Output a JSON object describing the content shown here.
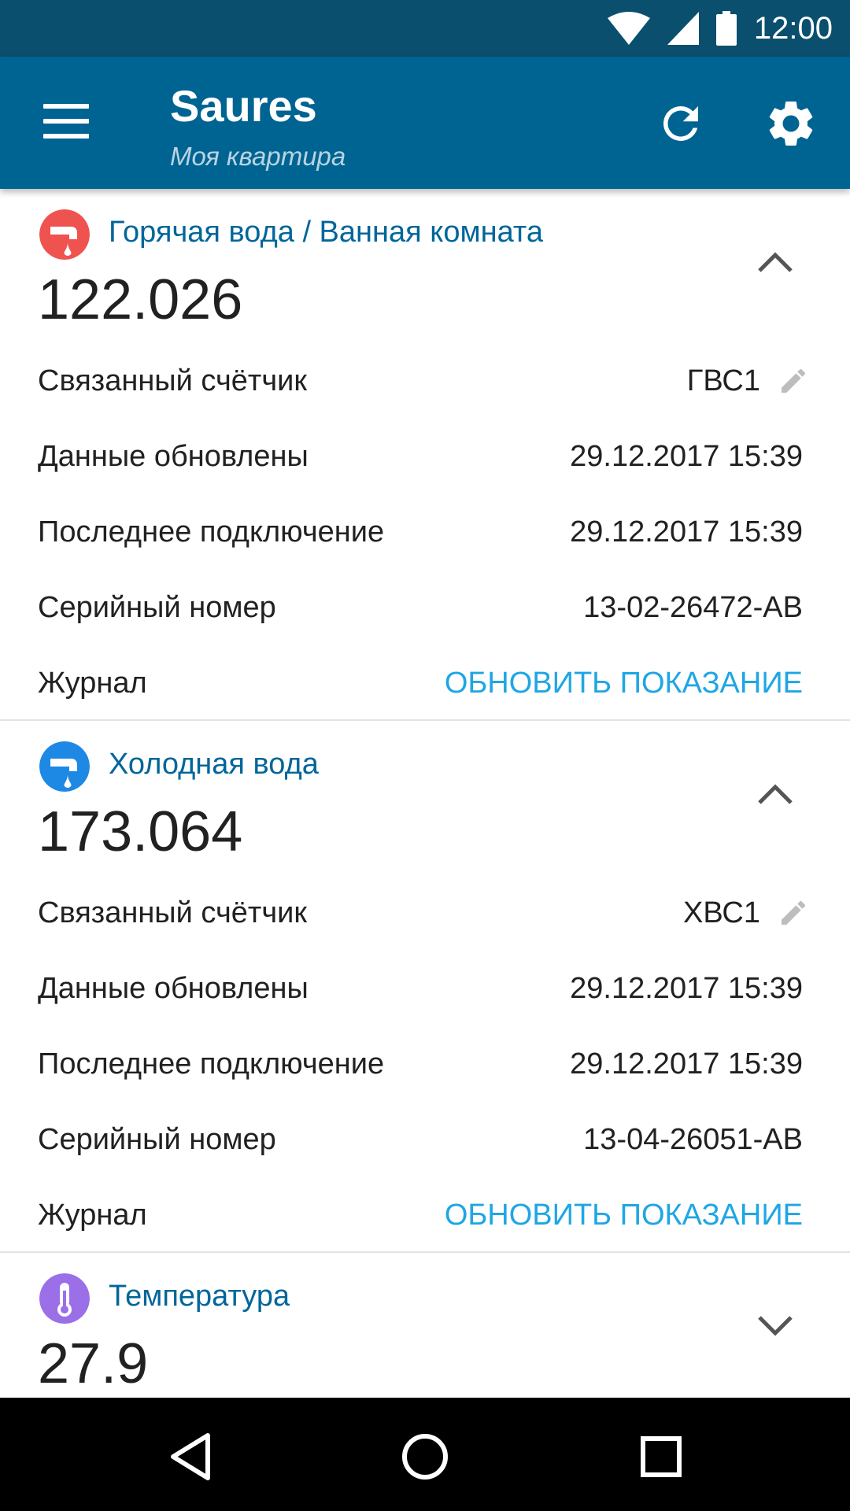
{
  "status_bar": {
    "time": "12:00",
    "icons": [
      "wifi-icon",
      "signal-icon",
      "battery-icon"
    ]
  },
  "app_bar": {
    "title": "Saures",
    "subtitle": "Моя квартира",
    "icons": [
      "menu-icon",
      "refresh-icon",
      "settings-icon"
    ]
  },
  "colors": {
    "accent": "#006493",
    "status": "#0b4f6e",
    "title_text": "#00669a",
    "link": "#1fa6e3",
    "hot": "#ef5350",
    "cold": "#1e88e5",
    "temp": "#9b6fe8"
  },
  "cards": [
    {
      "icon": "hot-water-icon",
      "title": "Горячая вода / Ванная комната",
      "value": "122.026",
      "expanded": true,
      "rows": {
        "linked_label": "Связанный счётчик",
        "linked_value": "ГВС1",
        "updated_label": "Данные обновлены",
        "updated_value": "29.12.2017 15:39",
        "connection_label": "Последнее подключение",
        "connection_value": "29.12.2017 15:39",
        "serial_label": "Серийный номер",
        "serial_value": "13-02-26472-AB",
        "journal_label": "Журнал",
        "update_action": "ОБНОВИТЬ ПОКАЗАНИЕ"
      }
    },
    {
      "icon": "cold-water-icon",
      "title": "Холодная вода",
      "value": "173.064",
      "expanded": true,
      "rows": {
        "linked_label": "Связанный счётчик",
        "linked_value": "ХВС1",
        "updated_label": "Данные обновлены",
        "updated_value": "29.12.2017 15:39",
        "connection_label": "Последнее подключение",
        "connection_value": "29.12.2017 15:39",
        "serial_label": "Серийный номер",
        "serial_value": "13-04-26051-AB",
        "journal_label": "Журнал",
        "update_action": "ОБНОВИТЬ ПОКАЗАНИЕ"
      }
    },
    {
      "icon": "thermometer-icon",
      "title": "Температура",
      "value": "27.9",
      "expanded": false
    }
  ],
  "nav_bar": {
    "icons": [
      "back-icon",
      "home-icon",
      "recents-icon"
    ]
  }
}
